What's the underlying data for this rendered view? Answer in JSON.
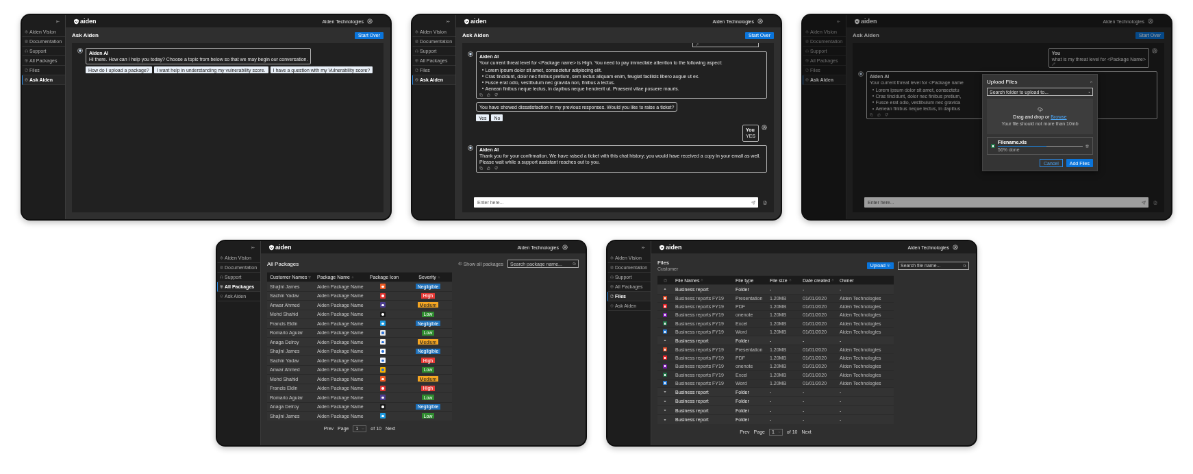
{
  "screens": [
    {
      "kind": "chat",
      "brand": "aiden",
      "org": "Aiden Technologies",
      "nav": [
        {
          "kind": "vision",
          "label": "Aiden Vision",
          "selected": false
        },
        {
          "kind": "docs",
          "label": "Documentation",
          "selected": false
        },
        {
          "kind": "support",
          "label": "Support",
          "selected": false
        },
        {
          "kind": "packages",
          "label": "All Packages",
          "selected": false
        },
        {
          "kind": "files",
          "label": "Files",
          "selected": false
        },
        {
          "kind": "ask",
          "label": "Ask Aiden",
          "selected": true
        }
      ],
      "title": "Ask Aiden",
      "action": "Start Over",
      "messages": [
        {
          "kind": "bot",
          "author": "Aiden AI",
          "text": "Hi there. How can I help you today? Choose a topic from below so that we may begin our conversation.",
          "suggestions": [
            "How do I upload a package?",
            "I want help in understanding my vulnerability score.",
            "I have a question with my Vulnerability score?"
          ]
        }
      ]
    },
    {
      "kind": "chat",
      "brand": "aiden",
      "org": "Aiden Technologies",
      "nav": [
        {
          "kind": "vision",
          "label": "Aiden Vision",
          "selected": false
        },
        {
          "kind": "docs",
          "label": "Documentation",
          "selected": false
        },
        {
          "kind": "support",
          "label": "Support",
          "selected": false
        },
        {
          "kind": "packages",
          "label": "All Packages",
          "selected": false
        },
        {
          "kind": "files",
          "label": "Files",
          "selected": false
        },
        {
          "kind": "ask",
          "label": "Ask Aiden",
          "selected": true
        }
      ],
      "title": "Ask Aiden",
      "action": "Start Over",
      "messages": [
        {
          "kind": "user_clipped",
          "editable": true
        },
        {
          "kind": "bot",
          "author": "Aiden AI",
          "text": "Your current threat level for <Package name> is High. You need to pay immediate attention to the following aspect:",
          "bullets": [
            "Lorem ipsum dolor sit amet, consectetur adipiscing elit.",
            "Cras tincidunt, dolor nec finibus pretium, sem lectus aliquam enim, feugiat facilisis libero augue ut ex.",
            "Fusce erat odio, vestibulum nec gravida non, finibus a lectus.",
            "Aenean finibus neque lectus, in dapibus neque hendrerit ut. Praesent vitae posuere mauris."
          ],
          "feedback": true
        },
        {
          "kind": "prompt",
          "text": "You have showed dissatisfaction in my previous responses. Would you like to raise a ticket?",
          "choices": [
            "Yes",
            "No"
          ]
        },
        {
          "kind": "user",
          "author": "You",
          "text": "YES"
        },
        {
          "kind": "bot",
          "author": "Aiden AI",
          "text": "Thank you for your confirmation. We have raised a ticket with this chat history; you would have received a copy in your email as well. Please wait while a support assistant reaches out to you.",
          "feedback": true
        }
      ],
      "composer": {
        "placeholder": "Enter here..."
      }
    },
    {
      "kind": "chat",
      "brand": "aiden",
      "org": "Aiden Technologies",
      "nav": [
        {
          "kind": "vision",
          "label": "Aiden Vision",
          "selected": false
        },
        {
          "kind": "docs",
          "label": "Documentation",
          "selected": false
        },
        {
          "kind": "support",
          "label": "Support",
          "selected": false
        },
        {
          "kind": "packages",
          "label": "All Packages",
          "selected": false
        },
        {
          "kind": "files",
          "label": "Files",
          "selected": false
        },
        {
          "kind": "ask",
          "label": "Ask Aiden",
          "selected": true
        }
      ],
      "title": "Ask Aiden",
      "action": "Start Over",
      "messages": [
        {
          "kind": "user",
          "author": "You",
          "text": "what is my threat level for <Package Name>",
          "editable": true
        },
        {
          "kind": "bot",
          "author": "Aiden AI",
          "text": "Your current threat level for <Package name",
          "bullets": [
            "Lorem ipsum dolor sit amet, consectetu",
            "Cras tincidunt, dolor nec finibus pretium,",
            "Fusce erat odio, vestibulum nec gravida",
            "Aenean finibus neque lectus, in dapibus"
          ],
          "feedback": true
        }
      ],
      "composer": {
        "placeholder": "Enter here..."
      },
      "modal": {
        "title": "Upload Files",
        "select": "Search folder to upload to...",
        "prompt": "Drag and drop or",
        "link": "Browse",
        "hint": "Your file should not more than 10mb",
        "file": {
          "name": "Filename.xls",
          "level": 0.57,
          "progress": "56% done"
        },
        "cancel": "Cancel",
        "confirm": "Add Files"
      }
    },
    {
      "kind": "packages",
      "brand": "aiden",
      "org": "Aiden Technologies",
      "nav": [
        {
          "kind": "vision",
          "label": "Aiden Vision",
          "selected": false
        },
        {
          "kind": "docs",
          "label": "Documentation",
          "selected": false
        },
        {
          "kind": "support",
          "label": "Support",
          "selected": false
        },
        {
          "kind": "packages",
          "label": "All Packages",
          "selected": true
        },
        {
          "kind": "ask",
          "label": "Ask Aiden",
          "selected": false
        }
      ],
      "title": "All Packages",
      "toggle": "Show all packages",
      "search": {
        "placeholder": "Search package name..."
      },
      "columns": [
        {
          "label": "Customer Names",
          "kind": "filter"
        },
        {
          "label": "Package Name",
          "kind": "sort"
        },
        {
          "label": "Package Icon",
          "kind": "plain"
        },
        {
          "label": "Severity",
          "kind": "sort"
        }
      ],
      "rows": [
        {
          "customer": "Shajini James",
          "package": "Aiden Package Name",
          "logo": {
            "color": "#ef5a24"
          },
          "severity": {
            "label": "Negligible",
            "color": "#1d6fb8"
          }
        },
        {
          "customer": "Sachin Yadav",
          "package": "Aiden Package Name",
          "logo": {
            "color": "#e0322f"
          },
          "severity": {
            "label": "High",
            "color": "#e53935"
          }
        },
        {
          "customer": "Anwar Ahmed",
          "package": "Aiden Package Name",
          "logo": {
            "color": "#4b3c8f"
          },
          "severity": {
            "label": "Medium",
            "color": "#f5a623"
          }
        },
        {
          "customer": "Mohd Shahid",
          "package": "Aiden Package Name",
          "logo": {
            "color": "#1a1a1a"
          },
          "severity": {
            "label": "Low",
            "color": "#2e8b2e"
          }
        },
        {
          "customer": "Francis Eldin",
          "package": "Aiden Package Name",
          "logo": {
            "color": "#1e9be0"
          },
          "severity": {
            "label": "Negligible",
            "color": "#1d6fb8"
          }
        },
        {
          "customer": "Romario Aguiar",
          "package": "Aiden Package Name",
          "logo": {
            "color": "#e8e8e8"
          },
          "severity": {
            "label": "Low",
            "color": "#2e8b2e"
          }
        },
        {
          "customer": "Anaga Delroy",
          "package": "Aiden Package Name",
          "logo": {
            "color": "#f4f4f4"
          },
          "severity": {
            "label": "Medium",
            "color": "#f5a623"
          }
        },
        {
          "customer": "Shajini James",
          "package": "Aiden Package Name",
          "logo": {
            "color": "#ffffff"
          },
          "severity": {
            "label": "Negligible",
            "color": "#1d6fb8"
          }
        },
        {
          "customer": "Sachin Yadav",
          "package": "Aiden Package Name",
          "logo": {
            "color": "#f0f4ff"
          },
          "severity": {
            "label": "High",
            "color": "#e53935"
          }
        },
        {
          "customer": "Anwar Ahmed",
          "package": "Aiden Package Name",
          "logo": {
            "color": "#f7b500"
          },
          "severity": {
            "label": "Low",
            "color": "#2e8b2e"
          }
        },
        {
          "customer": "Mohd Shahid",
          "package": "Aiden Package Name",
          "logo": {
            "color": "#ef5a24"
          },
          "severity": {
            "label": "Medium",
            "color": "#f5a623"
          }
        },
        {
          "customer": "Francis Eldin",
          "package": "Aiden Package Name",
          "logo": {
            "color": "#e0322f"
          },
          "severity": {
            "label": "High",
            "color": "#e53935"
          }
        },
        {
          "customer": "Romario Aguiar",
          "package": "Aiden Package Name",
          "logo": {
            "color": "#4b3c8f"
          },
          "severity": {
            "label": "Low",
            "color": "#2e8b2e"
          }
        },
        {
          "customer": "Anaga Delroy",
          "package": "Aiden Package Name",
          "logo": {
            "color": "#1a1a1a"
          },
          "severity": {
            "label": "Negligible",
            "color": "#1d6fb8"
          }
        },
        {
          "customer": "Shajini James",
          "package": "Aiden Package Name",
          "logo": {
            "color": "#1e9be0"
          },
          "severity": {
            "label": "Low",
            "color": "#2e8b2e"
          }
        }
      ],
      "pagination": {
        "prev": "Prev",
        "page_label": "Page",
        "page": "1",
        "total": "of 10",
        "next": "Next"
      }
    },
    {
      "kind": "files",
      "brand": "aiden",
      "org": "Aiden Technologies",
      "nav": [
        {
          "kind": "vision",
          "label": "Aiden Vision",
          "selected": false
        },
        {
          "kind": "docs",
          "label": "Documentation",
          "selected": false
        },
        {
          "kind": "support",
          "label": "Support",
          "selected": false
        },
        {
          "kind": "packages",
          "label": "All Packages",
          "selected": false
        },
        {
          "kind": "files",
          "label": "Files",
          "selected": true
        },
        {
          "kind": "ask",
          "label": "Ask Aiden",
          "selected": false
        }
      ],
      "title": "Files",
      "subtitle": "Customer",
      "upload": "Upload",
      "search": {
        "placeholder": "Search file name..."
      },
      "columns": [
        {
          "label": "File Names",
          "kind": "sort"
        },
        {
          "label": "File type",
          "kind": "plain"
        },
        {
          "label": "File size",
          "kind": "sort"
        },
        {
          "label": "Date created",
          "kind": "sort"
        },
        {
          "label": "Owner",
          "kind": "plain"
        }
      ],
      "folders": [
        {
          "name": "Business report",
          "type": "Folder",
          "size": "-",
          "date": "-",
          "owner": "-",
          "expanded": true,
          "children": [
            {
              "name": "Business reports FY19",
              "type": "Presentation",
              "size": "1.20MB",
              "date": "01/01/2020",
              "owner": "Aiden Technologies",
              "color": "#d24726"
            },
            {
              "name": "Business reports FY19",
              "type": "PDF",
              "size": "1.20MB",
              "date": "01/01/2020",
              "owner": "Aiden Technologies",
              "color": "#e5252a"
            },
            {
              "name": "Business reports FY19",
              "type": "onenote",
              "size": "1.20MB",
              "date": "01/01/2020",
              "owner": "Aiden Technologies",
              "color": "#7719aa"
            },
            {
              "name": "Business reports FY19",
              "type": "Excel",
              "size": "1.20MB",
              "date": "01/01/2020",
              "owner": "Aiden Technologies",
              "color": "#217346"
            },
            {
              "name": "Business reports FY19",
              "type": "Word",
              "size": "1.20MB",
              "date": "01/01/2020",
              "owner": "Aiden Technologies",
              "color": "#2b7cd3"
            }
          ]
        },
        {
          "name": "Business report",
          "type": "Folder",
          "size": "-",
          "date": "-",
          "owner": "-",
          "expanded": true,
          "children": [
            {
              "name": "Business reports FY19",
              "type": "Presentation",
              "size": "1.20MB",
              "date": "01/01/2020",
              "owner": "Aiden Technologies",
              "color": "#d24726"
            },
            {
              "name": "Business reports FY19",
              "type": "PDF",
              "size": "1.20MB",
              "date": "01/01/2020",
              "owner": "Aiden Technologies",
              "color": "#e5252a"
            },
            {
              "name": "Business reports FY19",
              "type": "onenote",
              "size": "1.20MB",
              "date": "01/01/2020",
              "owner": "Aiden Technologies",
              "color": "#7719aa"
            },
            {
              "name": "Business reports FY19",
              "type": "Excel",
              "size": "1.20MB",
              "date": "01/01/2020",
              "owner": "Aiden Technologies",
              "color": "#217346"
            },
            {
              "name": "Business reports FY19",
              "type": "Word",
              "size": "1.20MB",
              "date": "01/01/2020",
              "owner": "Aiden Technologies",
              "color": "#2b7cd3"
            }
          ]
        },
        {
          "name": "Business report",
          "type": "Folder",
          "size": "-",
          "date": "-",
          "owner": "-",
          "expanded": false
        },
        {
          "name": "Business report",
          "type": "Folder",
          "size": "-",
          "date": "-",
          "owner": "-",
          "expanded": false
        },
        {
          "name": "Business report",
          "type": "Folder",
          "size": "-",
          "date": "-",
          "owner": "-",
          "expanded": false
        },
        {
          "name": "Business report",
          "type": "Folder",
          "size": "-",
          "date": "-",
          "owner": "-",
          "expanded": false
        }
      ],
      "pagination": {
        "prev": "Prev",
        "page_label": "Page",
        "page": "1",
        "total": "of 10",
        "next": "Next"
      }
    }
  ]
}
